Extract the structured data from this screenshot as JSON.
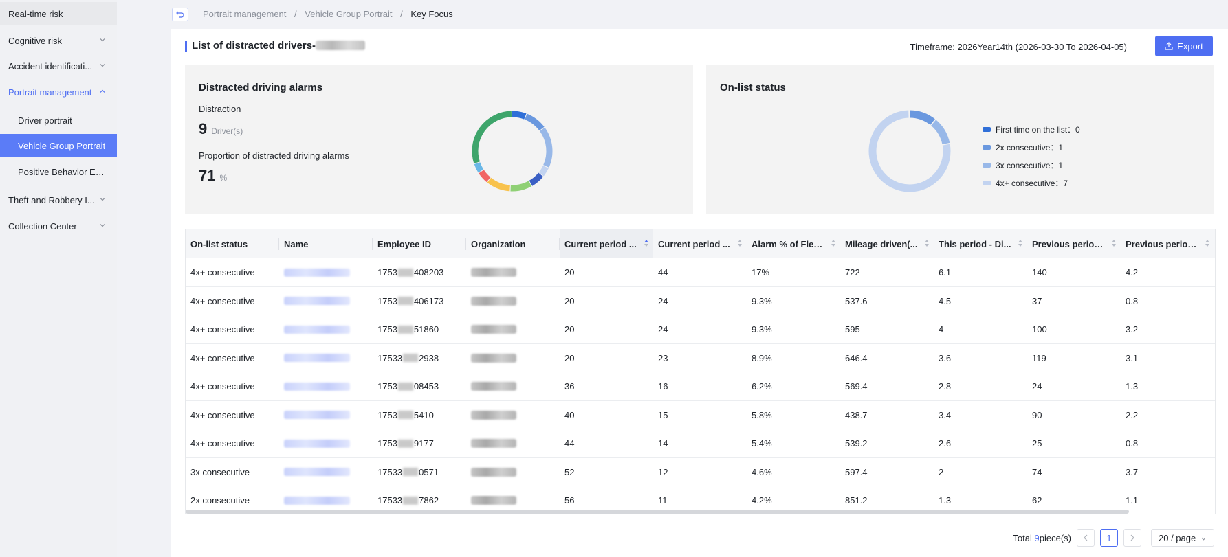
{
  "sidebar": {
    "items": [
      {
        "label": "Real-time risk"
      },
      {
        "label": "Cognitive risk"
      },
      {
        "label": "Accident identificati..."
      },
      {
        "label": "Portrait management"
      },
      {
        "label": "Driver portrait"
      },
      {
        "label": "Vehicle Group Portrait"
      },
      {
        "label": "Positive Behavior Ev..."
      },
      {
        "label": "Theft and Robbery I..."
      },
      {
        "label": "Collection Center"
      }
    ]
  },
  "breadcrumb": {
    "items": [
      "Portrait management",
      "Vehicle Group Portrait",
      "Key Focus"
    ],
    "separator": "/"
  },
  "header": {
    "title": "List of distracted drivers-",
    "timeframe": "Timeframe: 2026Year14th (2026-03-30 To 2026-04-05)",
    "export_label": "Export"
  },
  "alarms_card": {
    "title": "Distracted driving alarms",
    "distraction_label": "Distraction",
    "distraction_value": "9",
    "distraction_unit": "Driver(s)",
    "proportion_label": "Proportion of distracted driving alarms",
    "proportion_value": "71",
    "proportion_unit": "%",
    "donut_colors": [
      "#2f6fd8",
      "#6a98df",
      "#98b8e8",
      "#c2d3f0",
      "#3a5fc4",
      "#8fd075",
      "#f8c24c",
      "#f16565",
      "#6ab7e6",
      "#3ea56b"
    ]
  },
  "status_card": {
    "title": "On-list status",
    "legend": [
      {
        "label": "First time on the list：0",
        "color": "#2f6fd8"
      },
      {
        "label": "2x consecutive：1",
        "color": "#6a98df"
      },
      {
        "label": "3x consecutive：1",
        "color": "#98b8e8"
      },
      {
        "label": "4x+ consecutive：7",
        "color": "#c2d3f0"
      }
    ],
    "donut_values": [
      0,
      1,
      1,
      7
    ]
  },
  "table": {
    "columns": [
      "On-list status",
      "Name",
      "Employee ID",
      "Organization",
      "Current period ...",
      "Current period ...",
      "Alarm % of Fleet T...",
      "Mileage driven(...",
      "This period - Di...",
      "Previous period...",
      "Previous period..."
    ],
    "rows": [
      {
        "status": "4x+ consecutive",
        "emp_prefix": "1753",
        "emp_suffix": "408203",
        "c5": "20",
        "c6": "44",
        "c7": "17%",
        "c8": "722",
        "c9": "6.1",
        "c10": "140",
        "c11": "4.2"
      },
      {
        "status": "4x+ consecutive",
        "emp_prefix": "1753",
        "emp_suffix": "406173",
        "c5": "20",
        "c6": "24",
        "c7": "9.3%",
        "c8": "537.6",
        "c9": "4.5",
        "c10": "37",
        "c11": "0.8"
      },
      {
        "status": "4x+ consecutive",
        "emp_prefix": "1753",
        "emp_suffix": "51860",
        "c5": "20",
        "c6": "24",
        "c7": "9.3%",
        "c8": "595",
        "c9": "4",
        "c10": "100",
        "c11": "3.2"
      },
      {
        "status": "4x+ consecutive",
        "emp_prefix": "17533",
        "emp_suffix": "2938",
        "c5": "20",
        "c6": "23",
        "c7": "8.9%",
        "c8": "646.4",
        "c9": "3.6",
        "c10": "119",
        "c11": "3.1"
      },
      {
        "status": "4x+ consecutive",
        "emp_prefix": "1753",
        "emp_suffix": "08453",
        "c5": "36",
        "c6": "16",
        "c7": "6.2%",
        "c8": "569.4",
        "c9": "2.8",
        "c10": "24",
        "c11": "1.3"
      },
      {
        "status": "4x+ consecutive",
        "emp_prefix": "1753",
        "emp_suffix": "5410",
        "c5": "40",
        "c6": "15",
        "c7": "5.8%",
        "c8": "438.7",
        "c9": "3.4",
        "c10": "90",
        "c11": "2.2"
      },
      {
        "status": "4x+ consecutive",
        "emp_prefix": "1753",
        "emp_suffix": "9177",
        "c5": "44",
        "c6": "14",
        "c7": "5.4%",
        "c8": "539.2",
        "c9": "2.6",
        "c10": "25",
        "c11": "0.8"
      },
      {
        "status": "3x consecutive",
        "emp_prefix": "17533",
        "emp_suffix": "0571",
        "c5": "52",
        "c6": "12",
        "c7": "4.6%",
        "c8": "597.4",
        "c9": "2",
        "c10": "74",
        "c11": "3.7"
      },
      {
        "status": "2x consecutive",
        "emp_prefix": "17533",
        "emp_suffix": "7862",
        "c5": "56",
        "c6": "11",
        "c7": "4.2%",
        "c8": "851.2",
        "c9": "1.3",
        "c10": "62",
        "c11": "1.1"
      }
    ]
  },
  "pagination": {
    "total_prefix": "Total",
    "total_count": "9",
    "total_suffix": "piece(s)",
    "current_page": "1",
    "page_size": "20 / page"
  },
  "colors": {
    "accent": "#4e6ef2",
    "sidebar_active": "#5b7cf7"
  }
}
